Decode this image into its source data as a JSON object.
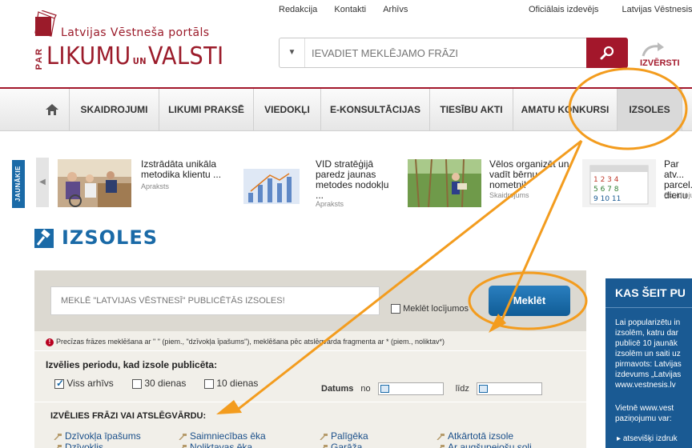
{
  "header": {
    "logo_top": "Latvijas Vēstneša portāls",
    "logo_par": "PAR",
    "logo_main_a": "LIKUMU",
    "logo_main_un": "UN",
    "logo_main_b": "VALSTI",
    "top_links": [
      "Redakcija",
      "Kontakti",
      "Arhīvs"
    ],
    "top_links_right": [
      "Oficiālais izdevējs",
      "Latvijas Vēstnesis"
    ],
    "search_placeholder": "IEVADIET MEKLĒJAMO FRĀZI",
    "search_dropdown": "▼",
    "izversti_label": "IZVĒRSTI"
  },
  "nav": {
    "items": [
      "SKAIDROJUMI",
      "LIKUMI PRAKSĒ",
      "VIEDOKĻI",
      "E-KONSULTĀCIJAS",
      "TIESĪBU AKTI",
      "AMATU KONKURSI",
      "IZSOLES"
    ],
    "active_index": 6
  },
  "carousel": {
    "label": "JAUNĀKIE",
    "prev_arrow": "◀",
    "items": [
      {
        "title": "Izstrādāta unikāla metodika klientu ...",
        "category": "Apraksts"
      },
      {
        "title": "VID stratēģijā paredz jaunas metodes nodokļu ...",
        "category": "Apraksts"
      },
      {
        "title": "Vēlos organizēt un vadīt bērnu nometni!",
        "category": "Skaidrojums"
      },
      {
        "title": "Par atv... parcel... dienu",
        "category": "Skaidrojums"
      }
    ]
  },
  "page_title": "IZSOLES",
  "search_panel": {
    "placeholder": "MEKLĒ \"LATVIJAS VĒSTNESĪ\" PUBLICĒTĀS IZSOLES!",
    "exact_label": "Meklēt locījumos",
    "button_label": "Meklēt",
    "hint": "Precīzas frāzes meklēšana ar \" \" (piem., \"dzīvokļa īpašums\"), meklēšana pēc atslēgvārda fragmenta ar * (piem., noliktav*)",
    "period_label": "Izvēlies periodu, kad izsole publicēta:",
    "period_options": [
      {
        "label": "Viss arhīvs",
        "checked": true
      },
      {
        "label": "30 dienas",
        "checked": false
      },
      {
        "label": "10 dienas",
        "checked": false
      }
    ],
    "dates_label": "Datums",
    "dates_from": "no",
    "dates_to": "līdz",
    "keywords_label": "IZVĒLIES FRĀZI VAI ATSLĒGVĀRDU:",
    "keywords": [
      [
        "Dzīvokļa īpašums",
        "Saimniecības ēka",
        "Palīgēka",
        "Atkārtotā izsole"
      ],
      [
        "Dzīvoklis",
        "Noliktavas ēka",
        "Garāža",
        "Ar augšupejošu soli"
      ]
    ]
  },
  "info_box": {
    "title": "KAS ŠEIT PU",
    "para1": [
      "Lai popularizētu in",
      "izsolēm, katru dar",
      "publicē 10 jaunāk",
      "izsolēm un saiti uz",
      "pirmavots: Latvijas",
      "izdevums „Latvijas",
      "www.vestnesis.lv"
    ],
    "para2": [
      "Vietnē www.vest",
      "paziņojumu var:"
    ],
    "bullet": "atsevišķi izdruk"
  },
  "colors": {
    "brand_red": "#a3172b",
    "brand_blue": "#1a6aa7",
    "annotation_orange": "#f39c1e"
  }
}
